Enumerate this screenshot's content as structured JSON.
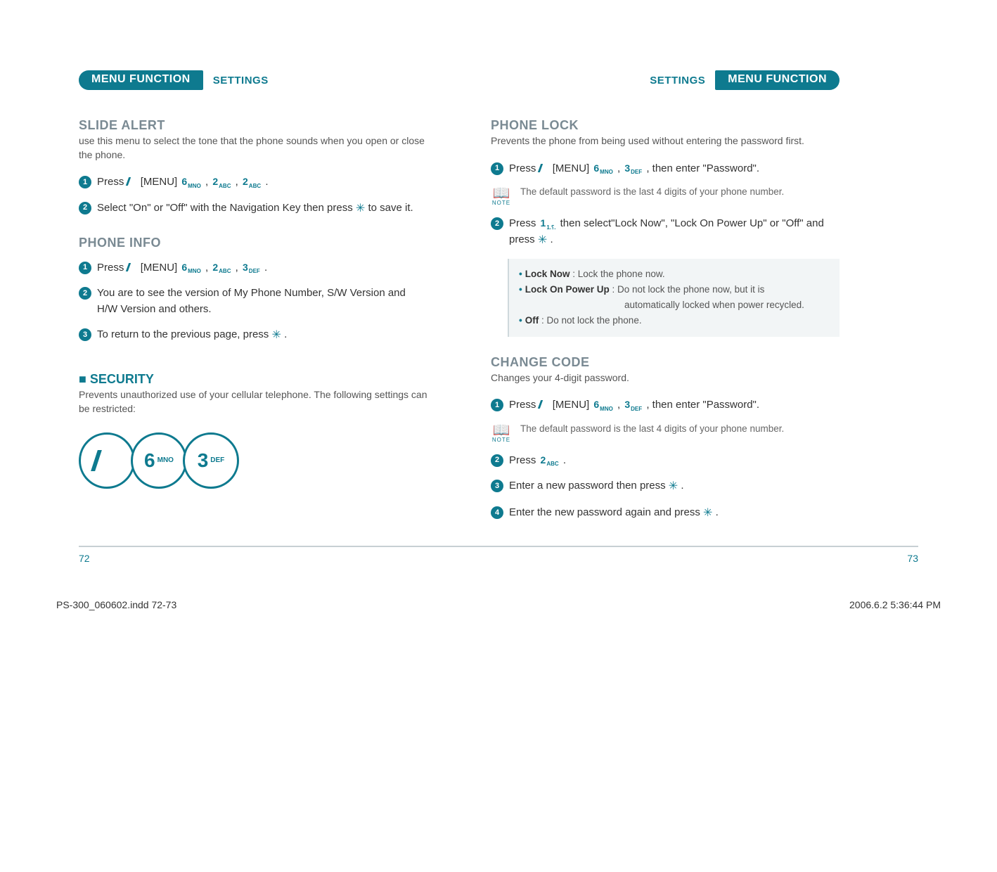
{
  "left": {
    "header_function": "MENU FUNCTION",
    "header_crumb": "SETTINGS",
    "slide_alert": {
      "title": "SLIDE ALERT",
      "intro": "use this menu to select the tone that the phone sounds when you open or close the phone.",
      "step1_a": "Press ",
      "step1_b": "[MENU] ",
      "step1_c": ", ",
      "step1_d": ", ",
      "step1_e": " .",
      "step2": "Select \"On\" or \"Off\" with the Navigation Key then press ",
      "step2_b": " to save it."
    },
    "phone_info": {
      "title": "PHONE INFO",
      "step1_a": "Press ",
      "step1_b": "[MENU] ",
      "step1_c": ", ",
      "step1_d": ", ",
      "step1_e": " .",
      "step2": "You are to see the version of My Phone Number, S/W Version and H/W Version and others.",
      "step3_a": "To return to the previous page, press ",
      "step3_b": "."
    },
    "security": {
      "title": "SECURITY",
      "intro": "Prevents unauthorized use of your cellular telephone. The following settings can be restricted:",
      "big6": "6",
      "big6_sub": "MNO",
      "big3": "3",
      "big3_sub": "DEF"
    },
    "page_num": "72"
  },
  "right": {
    "header_function": "MENU FUNCTION",
    "header_crumb": "SETTINGS",
    "phone_lock": {
      "title": "PHONE LOCK",
      "intro": "Prevents the phone from being used without entering the password first.",
      "step1_a": "Press ",
      "step1_b": "[MENU] ",
      "step1_c": ", ",
      "step1_d": ", then enter \"Password\".",
      "note": "The default password is the last 4 digits of your phone number.",
      "step2_a": "Press ",
      "step2_b": " then select\"Lock Now\", \"Lock On Power Up\" or \"Off\" and press ",
      "step2_c": ".",
      "opt_lock_now_label": "Lock Now",
      "opt_lock_now": " : Lock the phone now.",
      "opt_lock_pu_label": "Lock On Power Up",
      "opt_lock_pu": " : Do not lock the phone now, but it is",
      "opt_lock_pu2": "automatically locked when power recycled.",
      "opt_off_label": "Off",
      "opt_off": " : Do not lock the phone."
    },
    "change_code": {
      "title": "CHANGE CODE",
      "intro": "Changes your 4-digit password.",
      "step1_a": "Press ",
      "step1_b": "[MENU] ",
      "step1_c": ", ",
      "step1_d": ", then enter \"Password\".",
      "note": "The default password is the last 4 digits of your phone number.",
      "step2_a": "Press ",
      "step2_b": " .",
      "step3_a": "Enter a new password then press ",
      "step3_b": ".",
      "step4_a": "Enter the new password again and press ",
      "step4_b": "."
    },
    "page_num": "73"
  },
  "keys": {
    "k1": "1",
    "k2": "2",
    "k3": "3",
    "k6": "6",
    "sub_mno": "MNO",
    "sub_abc": "ABC",
    "sub_def": "DEF",
    "sub_1": "1.؟."
  },
  "print": {
    "file": "PS-300_060602.indd   72-73",
    "stamp": "2006.6.2   5:36:44 PM"
  }
}
